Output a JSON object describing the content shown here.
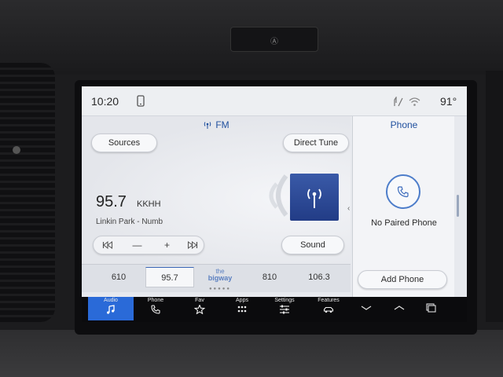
{
  "bezel": {
    "button_glyph": "Ⓐ"
  },
  "status_bar": {
    "time": "10:20",
    "temperature": "91°"
  },
  "audio": {
    "source_title": "FM",
    "sources_label": "Sources",
    "direct_tune_label": "Direct Tune",
    "sound_label": "Sound",
    "frequency": "95.7",
    "callsign": "KKHH",
    "now_playing": "Linkin Park - Numb",
    "controls": {
      "prev": "⏮",
      "minus": "—",
      "plus": "+",
      "next": "⏭"
    }
  },
  "presets": {
    "items": [
      "610",
      "95.7",
      "810",
      "106.3"
    ],
    "active": "95.7",
    "logo_text": [
      "the",
      "bigway"
    ]
  },
  "phone": {
    "title": "Phone",
    "status": "No Paired Phone",
    "add_phone_label": "Add Phone"
  },
  "nav": {
    "audio": "Audio",
    "phone": "Phone",
    "fav": "Fav",
    "apps": "Apps",
    "settings": "Settings",
    "features": "Features"
  },
  "colors": {
    "accent": "#2a6ad8",
    "title_blue": "#1f4f9e",
    "station_art": "#2b479a"
  }
}
